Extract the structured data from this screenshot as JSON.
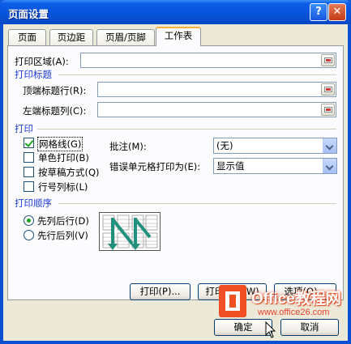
{
  "window": {
    "title": "页面设置",
    "help_glyph": "?",
    "close_glyph": "✕"
  },
  "tabs": [
    {
      "label": "页面"
    },
    {
      "label": "页边距"
    },
    {
      "label": "页眉/页脚"
    },
    {
      "label": "工作表"
    }
  ],
  "print_area": {
    "label": "打印区域(A):",
    "value": ""
  },
  "print_titles": {
    "group_label": "打印标题",
    "top_rows_label": "顶端标题行(R):",
    "top_rows_value": "",
    "left_cols_label": "左端标题列(C):",
    "left_cols_value": ""
  },
  "print": {
    "group_label": "打印",
    "gridlines": {
      "label": "网格线(G)",
      "checked": true
    },
    "black_white": {
      "label": "单色打印(B)",
      "checked": false
    },
    "draft": {
      "label": "按草稿方式(Q)",
      "checked": false
    },
    "row_col_headings": {
      "label": "行号列标(L)",
      "checked": false
    },
    "comments_label": "批注(M):",
    "comments_value": "(无)",
    "errors_label": "错误单元格打印为(E):",
    "errors_value": "显示值"
  },
  "page_order": {
    "group_label": "打印顺序",
    "down_then_over": {
      "label": "先列后行(D)",
      "selected": true
    },
    "over_then_down": {
      "label": "先行后列(V)",
      "selected": false
    }
  },
  "buttons": {
    "print": "打印(P)...",
    "print_preview": "打印预览(W)",
    "options": "选项(O)...",
    "ok": "确定",
    "cancel": "取消"
  },
  "watermark": {
    "brand": "Office教程网",
    "url": "www.office26.com"
  }
}
